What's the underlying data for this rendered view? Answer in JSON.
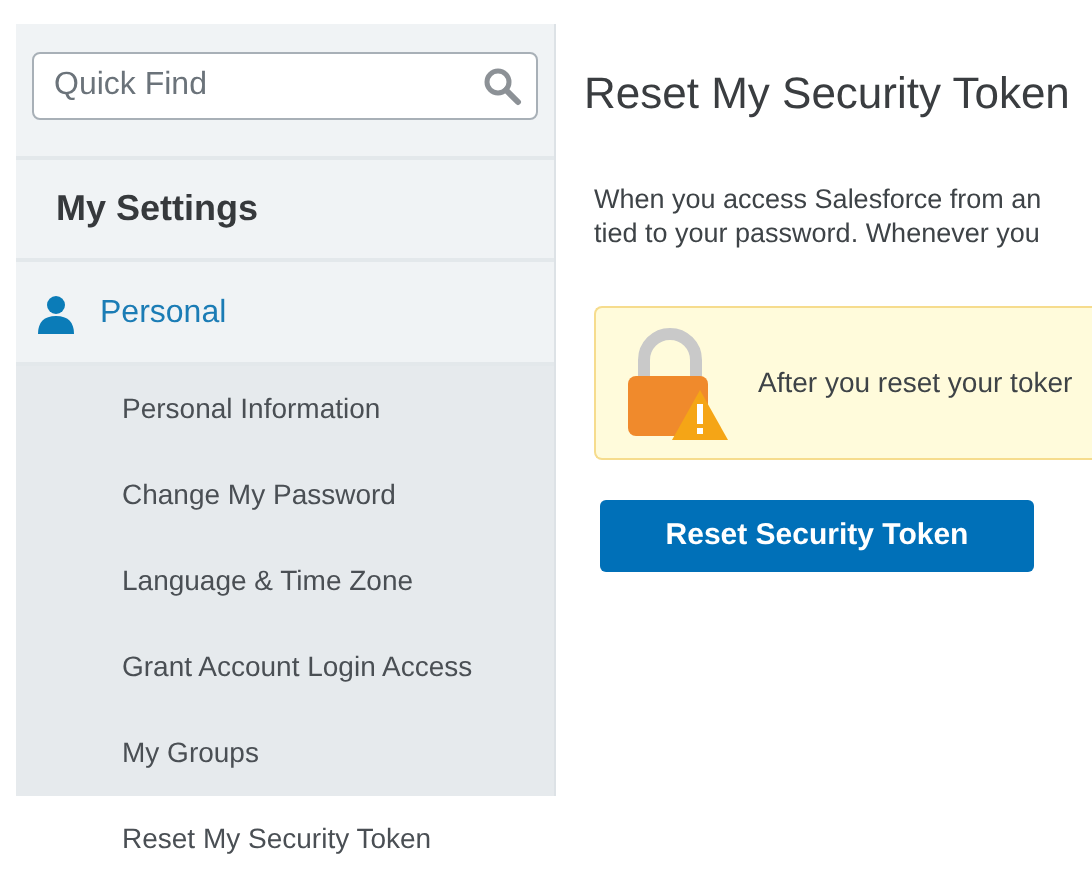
{
  "sidebar": {
    "search": {
      "placeholder": "Quick Find"
    },
    "heading": "My Settings",
    "section": {
      "label": "Personal",
      "items": [
        {
          "label": "Personal Information",
          "selected": false
        },
        {
          "label": "Change My Password",
          "selected": false
        },
        {
          "label": "Language & Time Zone",
          "selected": false
        },
        {
          "label": "Grant Account Login Access",
          "selected": false
        },
        {
          "label": "My Groups",
          "selected": false
        },
        {
          "label": "Reset My Security Token",
          "selected": true
        }
      ]
    }
  },
  "main": {
    "title": "Reset My Security Token",
    "description": [
      "When you access Salesforce from an",
      "tied to your password. Whenever you"
    ],
    "warning": {
      "text": "After you reset your toker"
    },
    "button": "Reset Security Token"
  }
}
